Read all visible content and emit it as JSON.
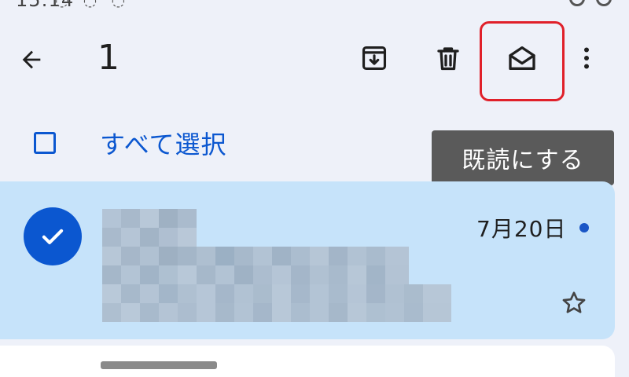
{
  "toolbar": {
    "selected_count": "1",
    "back_icon": "arrow-back-icon",
    "archive_icon": "archive-icon",
    "delete_icon": "trash-icon",
    "mark_read_icon": "mail-open-icon",
    "more_icon": "more-vert-icon"
  },
  "select_all": {
    "label": "すべて選択"
  },
  "tooltip": {
    "text": "既読にする"
  },
  "email": {
    "date": "7月20日",
    "selected": true,
    "unread": true
  },
  "colors": {
    "background": "#eef1f9",
    "accent": "#0b57d0",
    "selected_row": "#c6e3fa",
    "tooltip_bg": "#5a5a5a",
    "highlight": "#e0202a"
  }
}
